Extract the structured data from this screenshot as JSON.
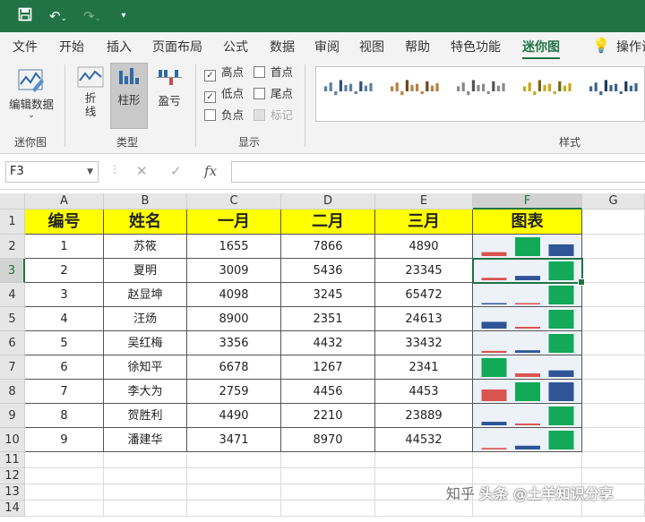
{
  "ribbon_tabs": [
    "文件",
    "开始",
    "插入",
    "页面布局",
    "公式",
    "数据",
    "审阅",
    "视图",
    "帮助",
    "特色功能",
    "迷你图",
    "操作说"
  ],
  "active_tab": 10,
  "groups": {
    "sparkline": {
      "label": "迷你图",
      "edit_data": "编辑数据"
    },
    "type": {
      "label": "类型",
      "line": "折线",
      "column": "柱形",
      "winloss": "盈亏"
    },
    "show": {
      "label": "显示",
      "options": [
        {
          "label": "高点",
          "checked": true,
          "disabled": false
        },
        {
          "label": "首点",
          "checked": false,
          "disabled": false
        },
        {
          "label": "低点",
          "checked": true,
          "disabled": false
        },
        {
          "label": "尾点",
          "checked": false,
          "disabled": false
        },
        {
          "label": "负点",
          "checked": false,
          "disabled": false
        },
        {
          "label": "标记",
          "checked": false,
          "disabled": true
        }
      ]
    },
    "style": {
      "label": "样式",
      "swatches": [
        {
          "bar": "#5b7fa6",
          "accent": "#2f4f78"
        },
        {
          "bar": "#b9803f",
          "accent": "#6b4a22"
        },
        {
          "bar": "#8a8a8a",
          "accent": "#555555"
        },
        {
          "bar": "#c8a81e",
          "accent": "#7a6612"
        },
        {
          "bar": "#3d6591",
          "accent": "#1e3a5c"
        }
      ]
    }
  },
  "formula_bar": {
    "name_box": "F3",
    "formula": "",
    "fx": "fx"
  },
  "columns": [
    "A",
    "B",
    "C",
    "D",
    "E",
    "F",
    "G"
  ],
  "selected_column": "F",
  "selected_row": 3,
  "row_numbers": [
    1,
    2,
    3,
    4,
    5,
    6,
    7,
    8,
    9,
    10,
    11,
    12,
    13,
    14
  ],
  "header_row": [
    "编号",
    "姓名",
    "一月",
    "二月",
    "三月",
    "图表"
  ],
  "table": [
    {
      "id": "1",
      "name": "苏筱",
      "jan": 1655,
      "feb": 7866,
      "mar": 4890
    },
    {
      "id": "2",
      "name": "夏明",
      "jan": 3009,
      "feb": 5436,
      "mar": 23345
    },
    {
      "id": "3",
      "name": "赵显坤",
      "jan": 4098,
      "feb": 3245,
      "mar": 65472
    },
    {
      "id": "4",
      "name": "汪炀",
      "jan": 8900,
      "feb": 2351,
      "mar": 24613
    },
    {
      "id": "5",
      "name": "吴红梅",
      "jan": 3356,
      "feb": 4432,
      "mar": 33432
    },
    {
      "id": "6",
      "name": "徐知平",
      "jan": 6678,
      "feb": 1267,
      "mar": 2341
    },
    {
      "id": "7",
      "name": "李大为",
      "jan": 2759,
      "feb": 4456,
      "mar": 4453
    },
    {
      "id": "8",
      "name": "贺胜利",
      "jan": 4490,
      "feb": 2210,
      "mar": 23889
    },
    {
      "id": "9",
      "name": "潘建华",
      "jan": 3471,
      "feb": 8970,
      "mar": 44532
    }
  ],
  "sparkline_colors": {
    "high": "#12a957",
    "low": "#d9534f",
    "normal": "#2f5597"
  },
  "watermark": {
    "part1": "知乎",
    "part2": "头条 @土羊知识分享"
  }
}
